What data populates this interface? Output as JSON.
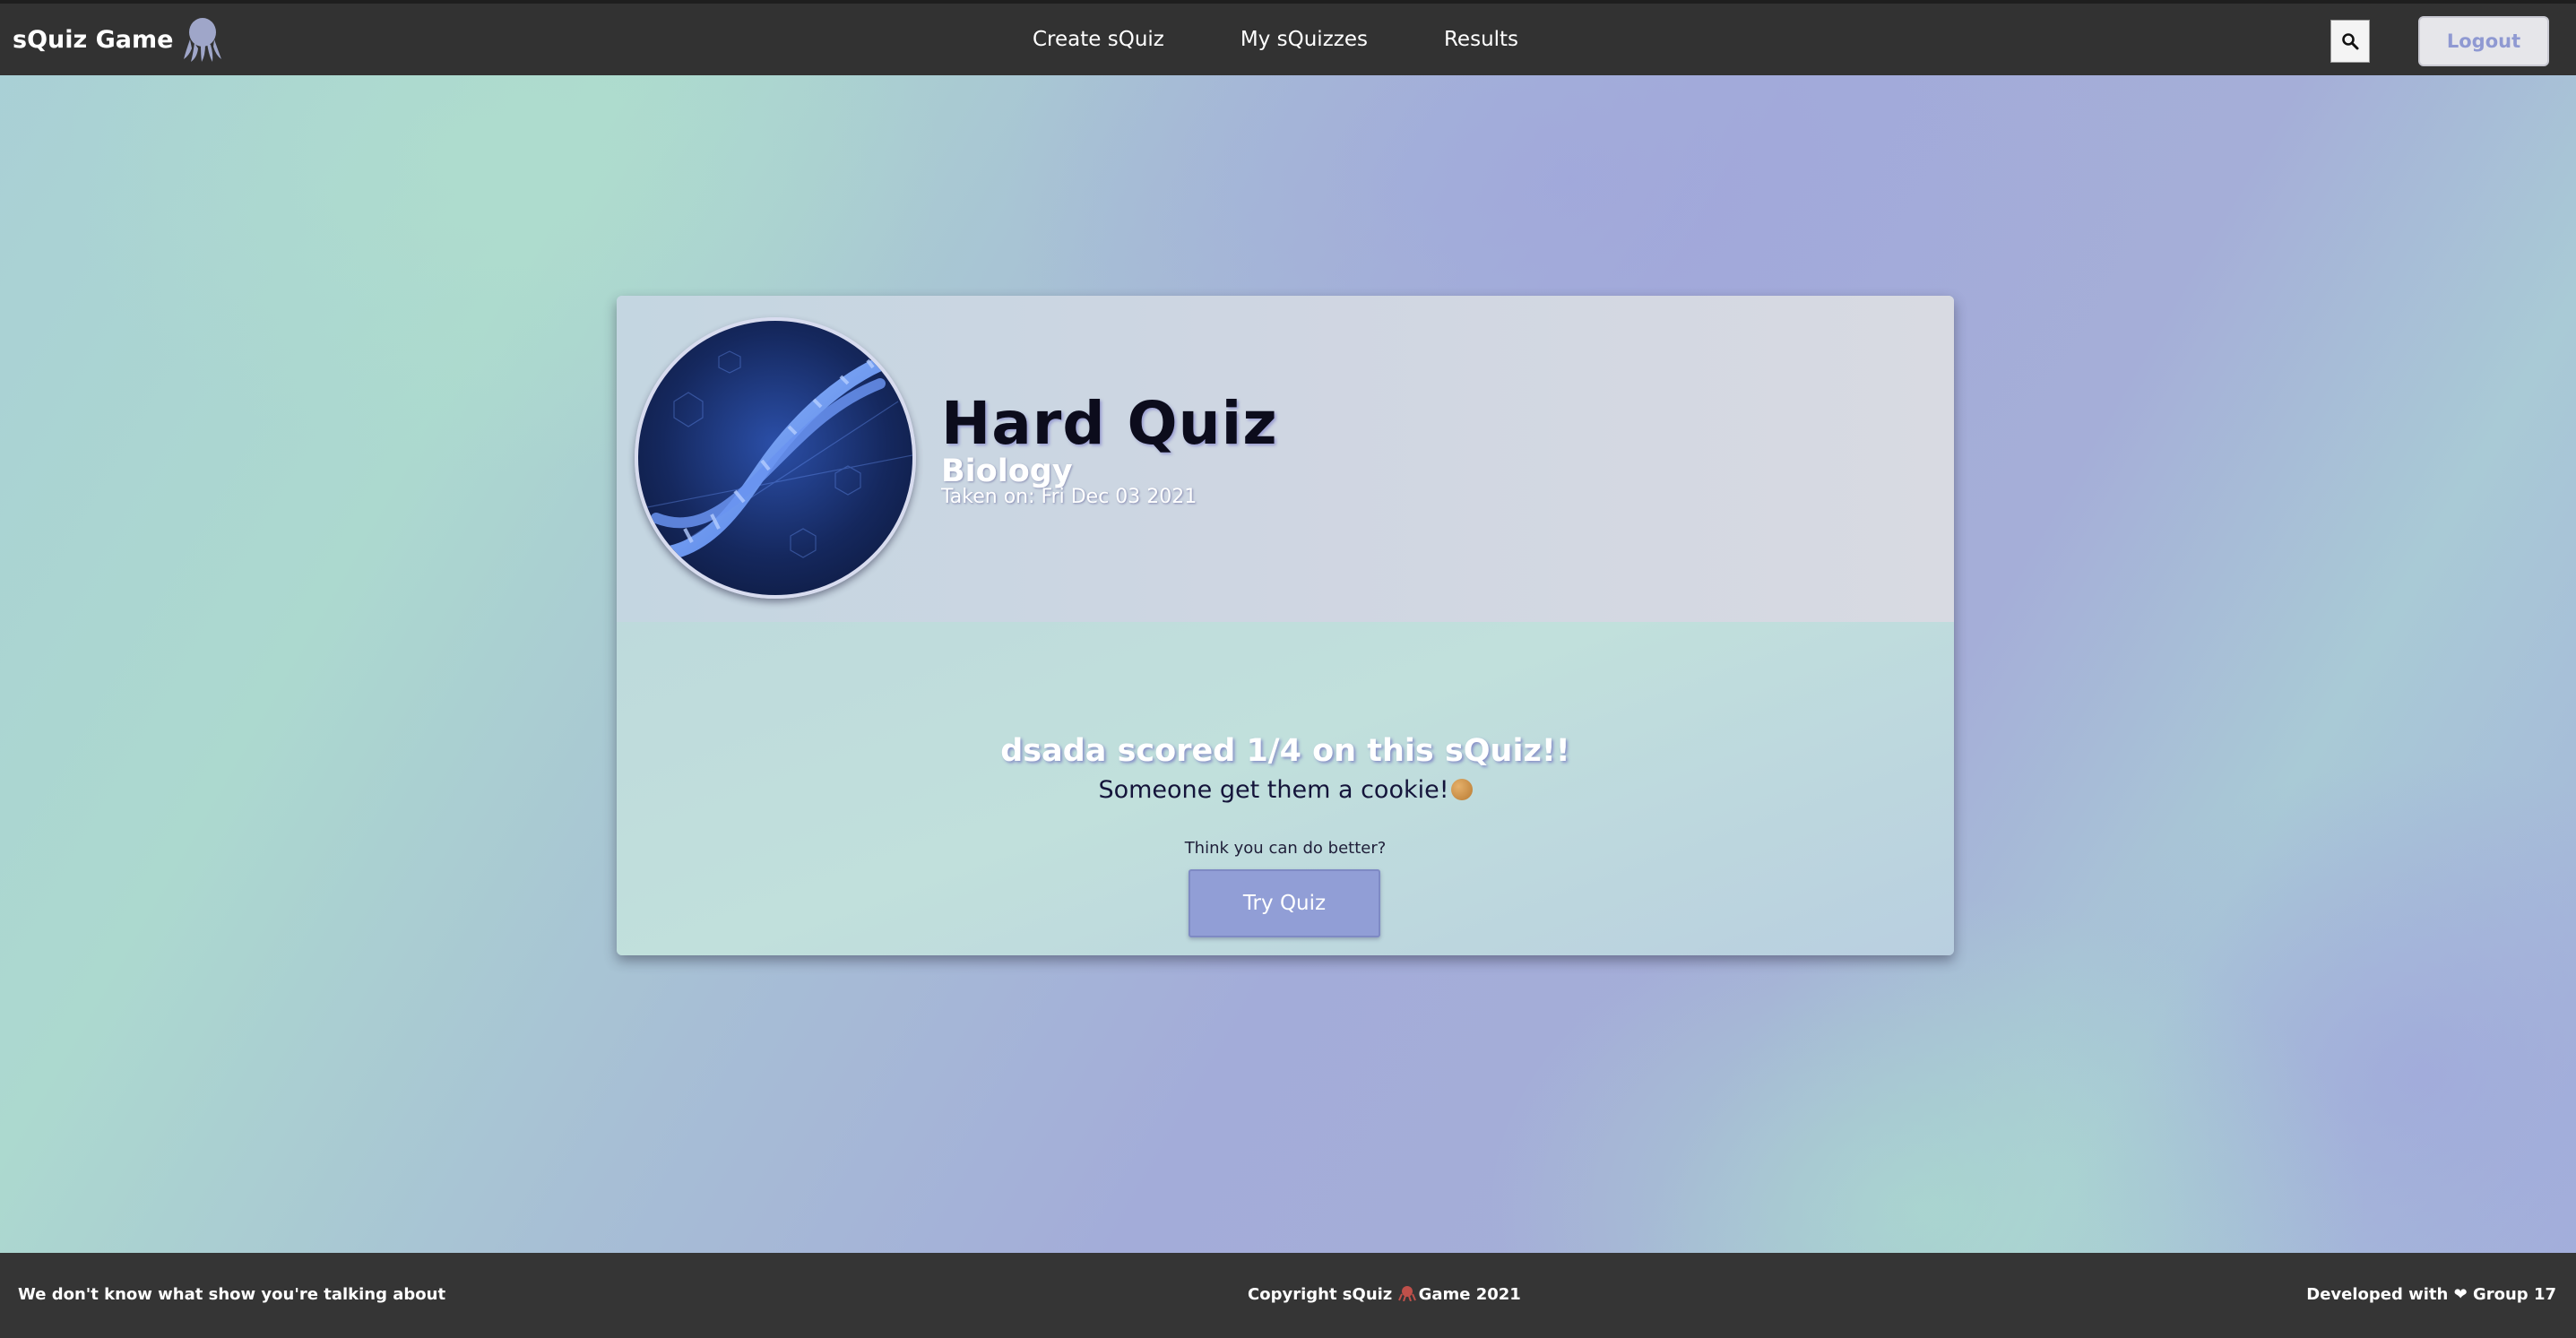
{
  "header": {
    "brand": "sQuiz Game",
    "nav": [
      "Create sQuiz",
      "My sQuizzes",
      "Results"
    ],
    "search_icon": "search-icon",
    "logout_label": "Logout"
  },
  "quiz": {
    "title": "Hard Quiz",
    "topic": "Biology",
    "taken_on": "Taken on: Fri Dec 03 2021",
    "score_line": "dsada scored 1/4 on this sQuiz!!",
    "cookie_line": "Someone get them a cookie!",
    "prompt": "Think you can do better?",
    "try_label": "Try Quiz",
    "image": "dna-helix-image"
  },
  "footer": {
    "left": "We don't know what show you're talking about",
    "center_pre": "Copyright sQuiz ",
    "center_post": "Game 2021",
    "right": "Developed with ❤ Group 17"
  },
  "colors": {
    "nav_bg": "#323232",
    "accent": "#919ed6",
    "footer_bg": "#353535"
  }
}
